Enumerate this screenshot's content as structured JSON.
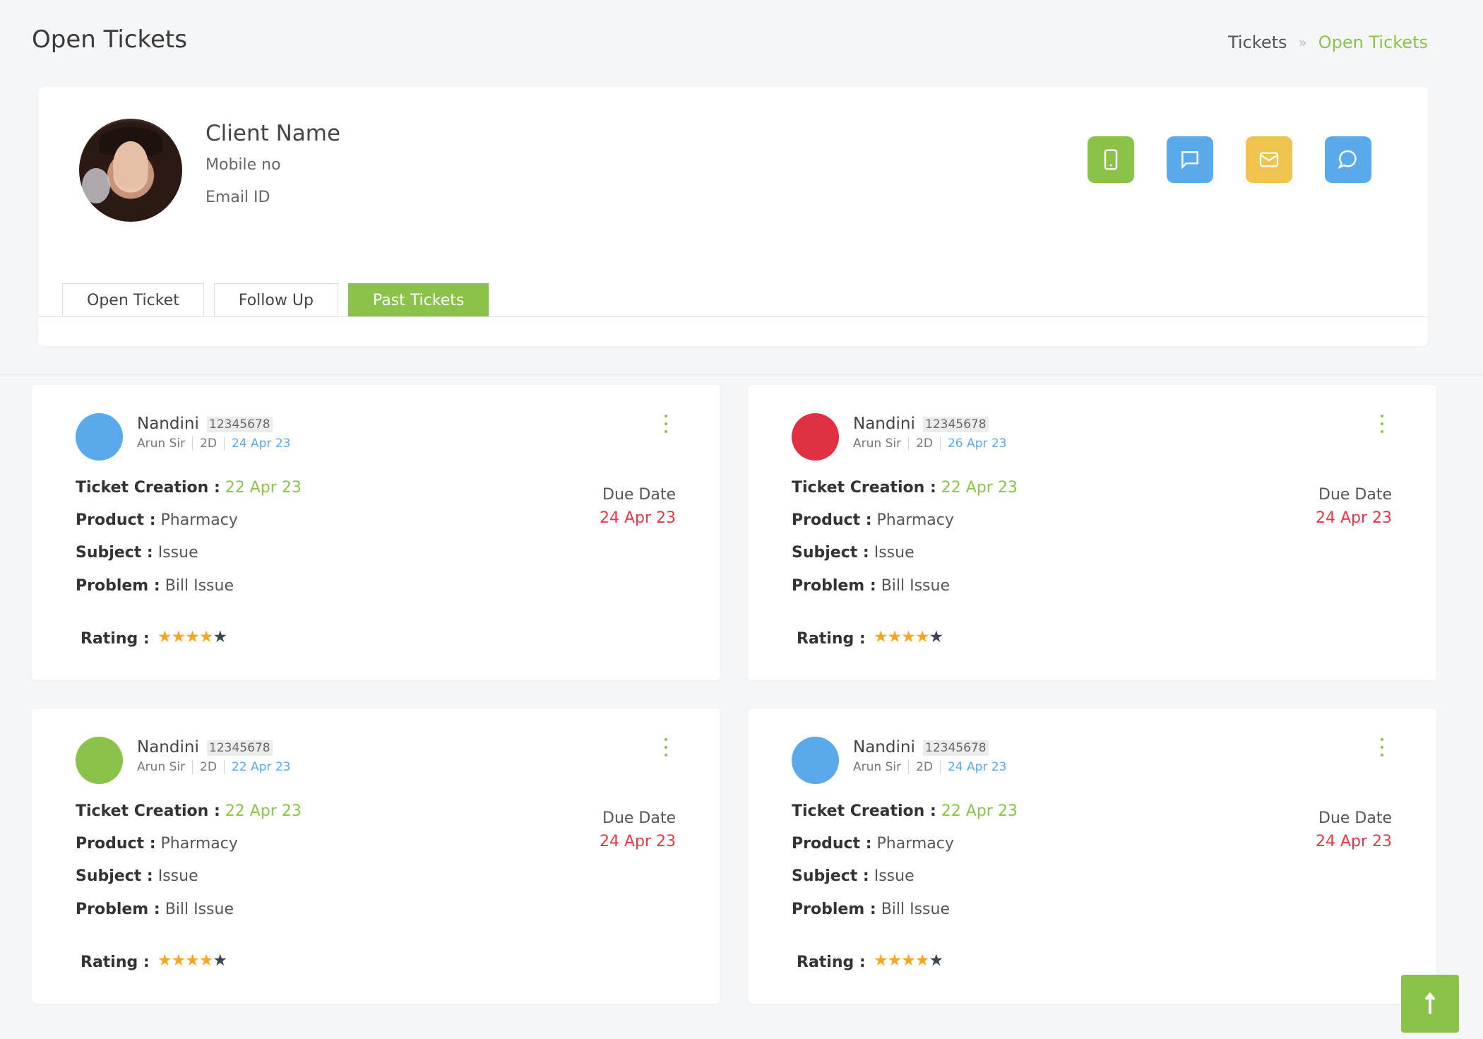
{
  "header": {
    "title": "Open Tickets",
    "breadcrumb": {
      "parent": "Tickets",
      "separator": "»",
      "current": "Open Tickets"
    }
  },
  "client": {
    "name": "Client Name",
    "mobile_label": "Mobile no",
    "email_label": "Email ID",
    "actions": [
      {
        "icon": "mobile-phone-icon",
        "color": "#8bc34a"
      },
      {
        "icon": "message-icon",
        "color": "#5aa9ea"
      },
      {
        "icon": "mail-icon",
        "color": "#efc34d"
      },
      {
        "icon": "chat-bubble-icon",
        "color": "#5aa9ea"
      }
    ]
  },
  "tabs": [
    {
      "label": "Open Ticket",
      "active": false
    },
    {
      "label": "Follow Up",
      "active": false
    },
    {
      "label": "Past Tickets",
      "active": true
    }
  ],
  "labels": {
    "ticket_creation": "Ticket Creation :",
    "product": "Product :",
    "subject": "Subject :",
    "problem": "Problem :",
    "due_date": "Due Date",
    "rating": "Rating :"
  },
  "tickets": [
    {
      "dot_color": "#5aa9ea",
      "name": "Nandini",
      "id": "12345678",
      "agent": "Arun Sir",
      "age": "2D",
      "date": "24 Apr 23",
      "creation": "22 Apr 23",
      "product": "Pharmacy",
      "subject": "Issue",
      "problem": "Bill Issue",
      "due": "24 Apr 23",
      "rating": 4,
      "rating_max": 5
    },
    {
      "dot_color": "#e03144",
      "name": "Nandini",
      "id": "12345678",
      "agent": "Arun Sir",
      "age": "2D",
      "date": "26 Apr 23",
      "creation": "22 Apr 23",
      "product": "Pharmacy",
      "subject": "Issue",
      "problem": "Bill Issue",
      "due": "24 Apr 23",
      "rating": 4,
      "rating_max": 5
    },
    {
      "dot_color": "#8bc34a",
      "name": "Nandini",
      "id": "12345678",
      "agent": "Arun Sir",
      "age": "2D",
      "date": "22 Apr 23",
      "creation": "22 Apr 23",
      "product": "Pharmacy",
      "subject": "Issue",
      "problem": "Bill Issue",
      "due": "24 Apr 23",
      "rating": 4,
      "rating_max": 5
    },
    {
      "dot_color": "#5aa9ea",
      "name": "Nandini",
      "id": "12345678",
      "agent": "Arun Sir",
      "age": "2D",
      "date": "24 Apr 23",
      "creation": "22 Apr 23",
      "product": "Pharmacy",
      "subject": "Issue",
      "problem": "Bill Issue",
      "due": "24 Apr 23",
      "rating": 4,
      "rating_max": 5
    }
  ],
  "colors": {
    "accent": "#8bc34a",
    "due": "#e53945",
    "link": "#5aa9ea",
    "star": "#f5a623"
  }
}
